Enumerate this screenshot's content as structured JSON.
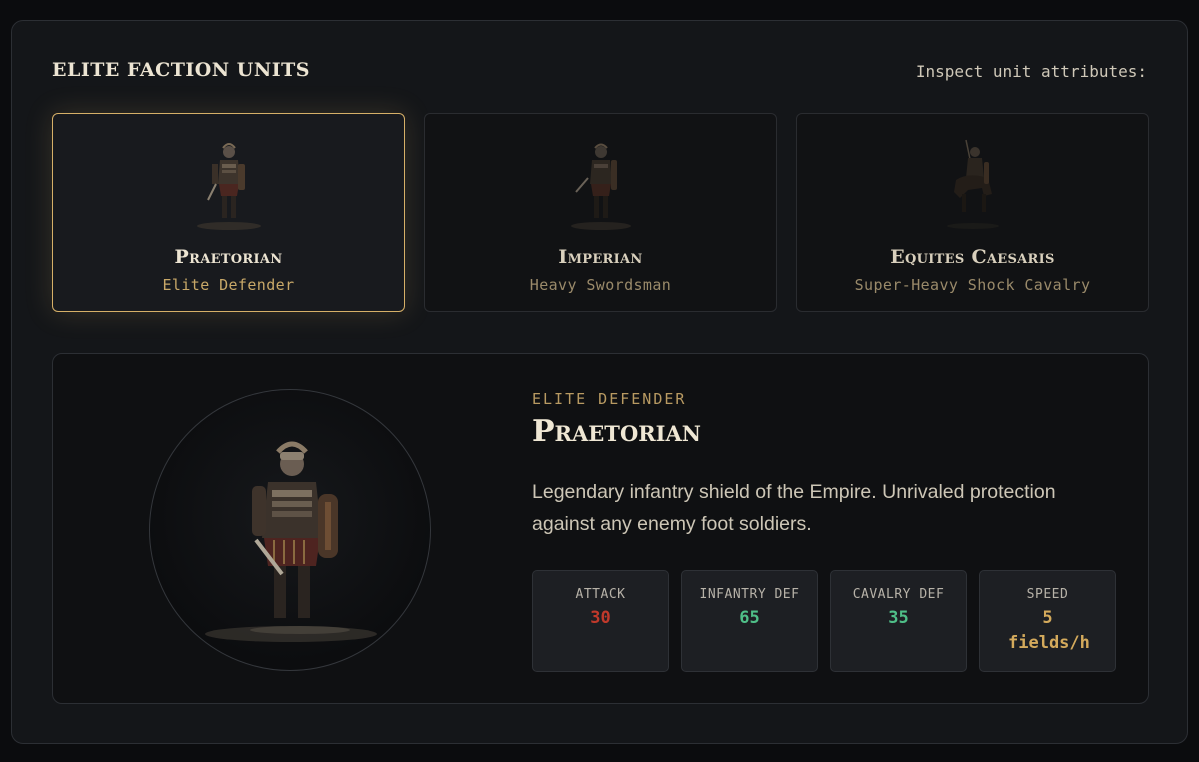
{
  "header": {
    "title": "ELITE FACTION UNITS",
    "hint": "Inspect unit attributes:"
  },
  "units": [
    {
      "name": "Praetorian",
      "role": "Elite Defender",
      "selected": true,
      "icon": "legionary-figure"
    },
    {
      "name": "Imperian",
      "role": "Heavy Swordsman",
      "selected": false,
      "icon": "swordsman-figure"
    },
    {
      "name": "Equites Caesaris",
      "role": "Super-Heavy Shock Cavalry",
      "selected": false,
      "icon": "cavalry-figure"
    }
  ],
  "detail": {
    "kicker": "ELITE DEFENDER",
    "name": "Praetorian",
    "description": "Legendary infantry shield of the Empire. Unrivaled protection against any enemy foot soldiers.",
    "stats": [
      {
        "label": "ATTACK",
        "value": "30",
        "color": "#c0392b"
      },
      {
        "label": "INFANTRY DEF",
        "value": "65",
        "color": "#4fbf88"
      },
      {
        "label": "CAVALRY DEF",
        "value": "35",
        "color": "#4fbf88"
      },
      {
        "label": "SPEED",
        "value": "5 fields/h",
        "color": "#d4aa5c"
      }
    ]
  },
  "colors": {
    "accent_gold": "#d6b068",
    "panel_bg": "#141619",
    "attack_red": "#c0392b",
    "defense_green": "#4fbf88"
  }
}
